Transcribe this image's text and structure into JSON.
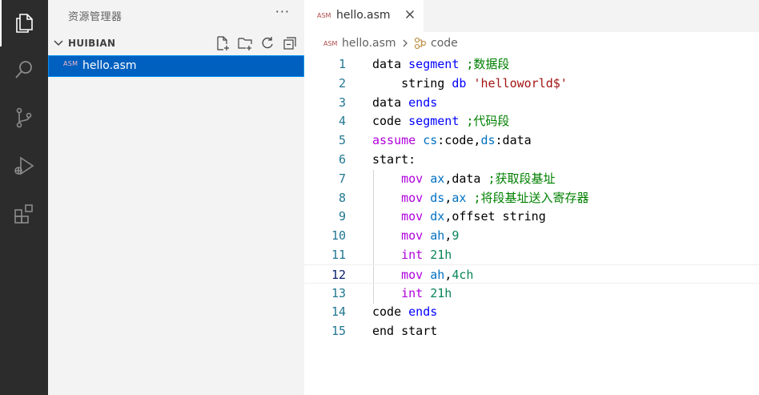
{
  "activity_bar": {
    "items": [
      {
        "icon": "explorer-icon",
        "active": true
      },
      {
        "icon": "search-icon",
        "active": false
      },
      {
        "icon": "source-control-icon",
        "active": false
      },
      {
        "icon": "run-debug-icon",
        "active": false
      },
      {
        "icon": "extensions-icon",
        "active": false
      }
    ]
  },
  "sidebar": {
    "title": "资源管理器",
    "more": "···",
    "section_title": "HUIBIAN",
    "files": [
      {
        "icon_text": "ASM",
        "label": "hello.asm",
        "selected": true
      }
    ]
  },
  "tabs": [
    {
      "icon_text": "ASM",
      "label": "hello.asm",
      "active": true
    }
  ],
  "breadcrumb": {
    "icon_text": "ASM",
    "file": "hello.asm",
    "symbol": "code"
  },
  "editor": {
    "current_line": 12,
    "lines": [
      {
        "n": "1",
        "tokens": [
          [
            "plain",
            "data "
          ],
          [
            "kw",
            "segment"
          ],
          [
            "plain",
            " "
          ],
          [
            "cmt",
            ";数据段"
          ]
        ]
      },
      {
        "n": "2",
        "tokens": [
          [
            "plain",
            "    string "
          ],
          [
            "kw",
            "db"
          ],
          [
            "plain",
            " "
          ],
          [
            "str",
            "'helloworld$'"
          ]
        ]
      },
      {
        "n": "3",
        "tokens": [
          [
            "plain",
            "data "
          ],
          [
            "kw",
            "ends"
          ]
        ]
      },
      {
        "n": "4",
        "tokens": [
          [
            "plain",
            "code "
          ],
          [
            "kw",
            "segment"
          ],
          [
            "plain",
            " "
          ],
          [
            "cmt",
            ";代码段"
          ]
        ]
      },
      {
        "n": "5",
        "tokens": [
          [
            "kw2",
            "assume"
          ],
          [
            "plain",
            " "
          ],
          [
            "reg",
            "cs"
          ],
          [
            "plain",
            ":code,"
          ],
          [
            "reg",
            "ds"
          ],
          [
            "plain",
            ":data"
          ]
        ]
      },
      {
        "n": "6",
        "tokens": [
          [
            "plain",
            "start:"
          ]
        ]
      },
      {
        "n": "7",
        "tokens": [
          [
            "plain",
            "    "
          ],
          [
            "kw2",
            "mov"
          ],
          [
            "plain",
            " "
          ],
          [
            "reg",
            "ax"
          ],
          [
            "plain",
            ",data "
          ],
          [
            "cmt",
            ";获取段基址"
          ]
        ]
      },
      {
        "n": "8",
        "tokens": [
          [
            "plain",
            "    "
          ],
          [
            "kw2",
            "mov"
          ],
          [
            "plain",
            " "
          ],
          [
            "reg",
            "ds"
          ],
          [
            "plain",
            ","
          ],
          [
            "reg",
            "ax"
          ],
          [
            "plain",
            " "
          ],
          [
            "cmt",
            ";将段基址送入寄存器"
          ]
        ]
      },
      {
        "n": "9",
        "tokens": [
          [
            "plain",
            "    "
          ],
          [
            "kw2",
            "mov"
          ],
          [
            "plain",
            " "
          ],
          [
            "reg",
            "dx"
          ],
          [
            "plain",
            ",offset string"
          ]
        ]
      },
      {
        "n": "10",
        "tokens": [
          [
            "plain",
            "    "
          ],
          [
            "kw2",
            "mov"
          ],
          [
            "plain",
            " "
          ],
          [
            "reg",
            "ah"
          ],
          [
            "plain",
            ","
          ],
          [
            "num",
            "9"
          ]
        ]
      },
      {
        "n": "11",
        "tokens": [
          [
            "plain",
            "    "
          ],
          [
            "kw2",
            "int"
          ],
          [
            "plain",
            " "
          ],
          [
            "num",
            "21h"
          ]
        ]
      },
      {
        "n": "12",
        "tokens": [
          [
            "plain",
            "    "
          ],
          [
            "kw2",
            "mov"
          ],
          [
            "plain",
            " "
          ],
          [
            "reg",
            "ah"
          ],
          [
            "plain",
            ","
          ],
          [
            "num",
            "4ch"
          ]
        ]
      },
      {
        "n": "13",
        "tokens": [
          [
            "plain",
            "    "
          ],
          [
            "kw2",
            "int"
          ],
          [
            "plain",
            " "
          ],
          [
            "num",
            "21h"
          ]
        ]
      },
      {
        "n": "14",
        "tokens": [
          [
            "plain",
            "code "
          ],
          [
            "kw",
            "ends"
          ]
        ]
      },
      {
        "n": "15",
        "tokens": [
          [
            "plain",
            "end start"
          ]
        ]
      }
    ]
  }
}
